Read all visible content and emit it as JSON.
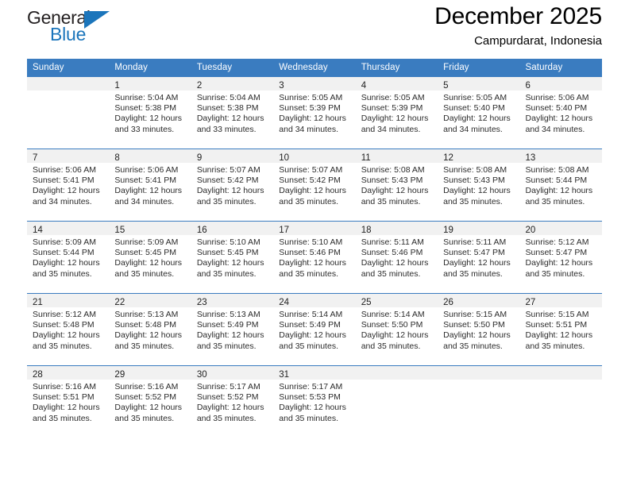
{
  "brand": {
    "name_top": "General",
    "name_bottom": "Blue",
    "accent_color": "#1b75bb",
    "triangle_icon": "triangle-icon"
  },
  "header": {
    "title": "December 2025",
    "subtitle": "Campurdarat, Indonesia"
  },
  "calendar": {
    "header_bg": "#3a7cc0",
    "daynum_bg": "#f1f1f1",
    "weekdays": [
      "Sunday",
      "Monday",
      "Tuesday",
      "Wednesday",
      "Thursday",
      "Friday",
      "Saturday"
    ],
    "weeks": [
      [
        {
          "day": "",
          "lines": []
        },
        {
          "day": "1",
          "lines": [
            "Sunrise: 5:04 AM",
            "Sunset: 5:38 PM",
            "Daylight: 12 hours",
            "and 33 minutes."
          ]
        },
        {
          "day": "2",
          "lines": [
            "Sunrise: 5:04 AM",
            "Sunset: 5:38 PM",
            "Daylight: 12 hours",
            "and 33 minutes."
          ]
        },
        {
          "day": "3",
          "lines": [
            "Sunrise: 5:05 AM",
            "Sunset: 5:39 PM",
            "Daylight: 12 hours",
            "and 34 minutes."
          ]
        },
        {
          "day": "4",
          "lines": [
            "Sunrise: 5:05 AM",
            "Sunset: 5:39 PM",
            "Daylight: 12 hours",
            "and 34 minutes."
          ]
        },
        {
          "day": "5",
          "lines": [
            "Sunrise: 5:05 AM",
            "Sunset: 5:40 PM",
            "Daylight: 12 hours",
            "and 34 minutes."
          ]
        },
        {
          "day": "6",
          "lines": [
            "Sunrise: 5:06 AM",
            "Sunset: 5:40 PM",
            "Daylight: 12 hours",
            "and 34 minutes."
          ]
        }
      ],
      [
        {
          "day": "7",
          "lines": [
            "Sunrise: 5:06 AM",
            "Sunset: 5:41 PM",
            "Daylight: 12 hours",
            "and 34 minutes."
          ]
        },
        {
          "day": "8",
          "lines": [
            "Sunrise: 5:06 AM",
            "Sunset: 5:41 PM",
            "Daylight: 12 hours",
            "and 34 minutes."
          ]
        },
        {
          "day": "9",
          "lines": [
            "Sunrise: 5:07 AM",
            "Sunset: 5:42 PM",
            "Daylight: 12 hours",
            "and 35 minutes."
          ]
        },
        {
          "day": "10",
          "lines": [
            "Sunrise: 5:07 AM",
            "Sunset: 5:42 PM",
            "Daylight: 12 hours",
            "and 35 minutes."
          ]
        },
        {
          "day": "11",
          "lines": [
            "Sunrise: 5:08 AM",
            "Sunset: 5:43 PM",
            "Daylight: 12 hours",
            "and 35 minutes."
          ]
        },
        {
          "day": "12",
          "lines": [
            "Sunrise: 5:08 AM",
            "Sunset: 5:43 PM",
            "Daylight: 12 hours",
            "and 35 minutes."
          ]
        },
        {
          "day": "13",
          "lines": [
            "Sunrise: 5:08 AM",
            "Sunset: 5:44 PM",
            "Daylight: 12 hours",
            "and 35 minutes."
          ]
        }
      ],
      [
        {
          "day": "14",
          "lines": [
            "Sunrise: 5:09 AM",
            "Sunset: 5:44 PM",
            "Daylight: 12 hours",
            "and 35 minutes."
          ]
        },
        {
          "day": "15",
          "lines": [
            "Sunrise: 5:09 AM",
            "Sunset: 5:45 PM",
            "Daylight: 12 hours",
            "and 35 minutes."
          ]
        },
        {
          "day": "16",
          "lines": [
            "Sunrise: 5:10 AM",
            "Sunset: 5:45 PM",
            "Daylight: 12 hours",
            "and 35 minutes."
          ]
        },
        {
          "day": "17",
          "lines": [
            "Sunrise: 5:10 AM",
            "Sunset: 5:46 PM",
            "Daylight: 12 hours",
            "and 35 minutes."
          ]
        },
        {
          "day": "18",
          "lines": [
            "Sunrise: 5:11 AM",
            "Sunset: 5:46 PM",
            "Daylight: 12 hours",
            "and 35 minutes."
          ]
        },
        {
          "day": "19",
          "lines": [
            "Sunrise: 5:11 AM",
            "Sunset: 5:47 PM",
            "Daylight: 12 hours",
            "and 35 minutes."
          ]
        },
        {
          "day": "20",
          "lines": [
            "Sunrise: 5:12 AM",
            "Sunset: 5:47 PM",
            "Daylight: 12 hours",
            "and 35 minutes."
          ]
        }
      ],
      [
        {
          "day": "21",
          "lines": [
            "Sunrise: 5:12 AM",
            "Sunset: 5:48 PM",
            "Daylight: 12 hours",
            "and 35 minutes."
          ]
        },
        {
          "day": "22",
          "lines": [
            "Sunrise: 5:13 AM",
            "Sunset: 5:48 PM",
            "Daylight: 12 hours",
            "and 35 minutes."
          ]
        },
        {
          "day": "23",
          "lines": [
            "Sunrise: 5:13 AM",
            "Sunset: 5:49 PM",
            "Daylight: 12 hours",
            "and 35 minutes."
          ]
        },
        {
          "day": "24",
          "lines": [
            "Sunrise: 5:14 AM",
            "Sunset: 5:49 PM",
            "Daylight: 12 hours",
            "and 35 minutes."
          ]
        },
        {
          "day": "25",
          "lines": [
            "Sunrise: 5:14 AM",
            "Sunset: 5:50 PM",
            "Daylight: 12 hours",
            "and 35 minutes."
          ]
        },
        {
          "day": "26",
          "lines": [
            "Sunrise: 5:15 AM",
            "Sunset: 5:50 PM",
            "Daylight: 12 hours",
            "and 35 minutes."
          ]
        },
        {
          "day": "27",
          "lines": [
            "Sunrise: 5:15 AM",
            "Sunset: 5:51 PM",
            "Daylight: 12 hours",
            "and 35 minutes."
          ]
        }
      ],
      [
        {
          "day": "28",
          "lines": [
            "Sunrise: 5:16 AM",
            "Sunset: 5:51 PM",
            "Daylight: 12 hours",
            "and 35 minutes."
          ]
        },
        {
          "day": "29",
          "lines": [
            "Sunrise: 5:16 AM",
            "Sunset: 5:52 PM",
            "Daylight: 12 hours",
            "and 35 minutes."
          ]
        },
        {
          "day": "30",
          "lines": [
            "Sunrise: 5:17 AM",
            "Sunset: 5:52 PM",
            "Daylight: 12 hours",
            "and 35 minutes."
          ]
        },
        {
          "day": "31",
          "lines": [
            "Sunrise: 5:17 AM",
            "Sunset: 5:53 PM",
            "Daylight: 12 hours",
            "and 35 minutes."
          ]
        },
        {
          "day": "",
          "lines": []
        },
        {
          "day": "",
          "lines": []
        },
        {
          "day": "",
          "lines": []
        }
      ]
    ]
  }
}
